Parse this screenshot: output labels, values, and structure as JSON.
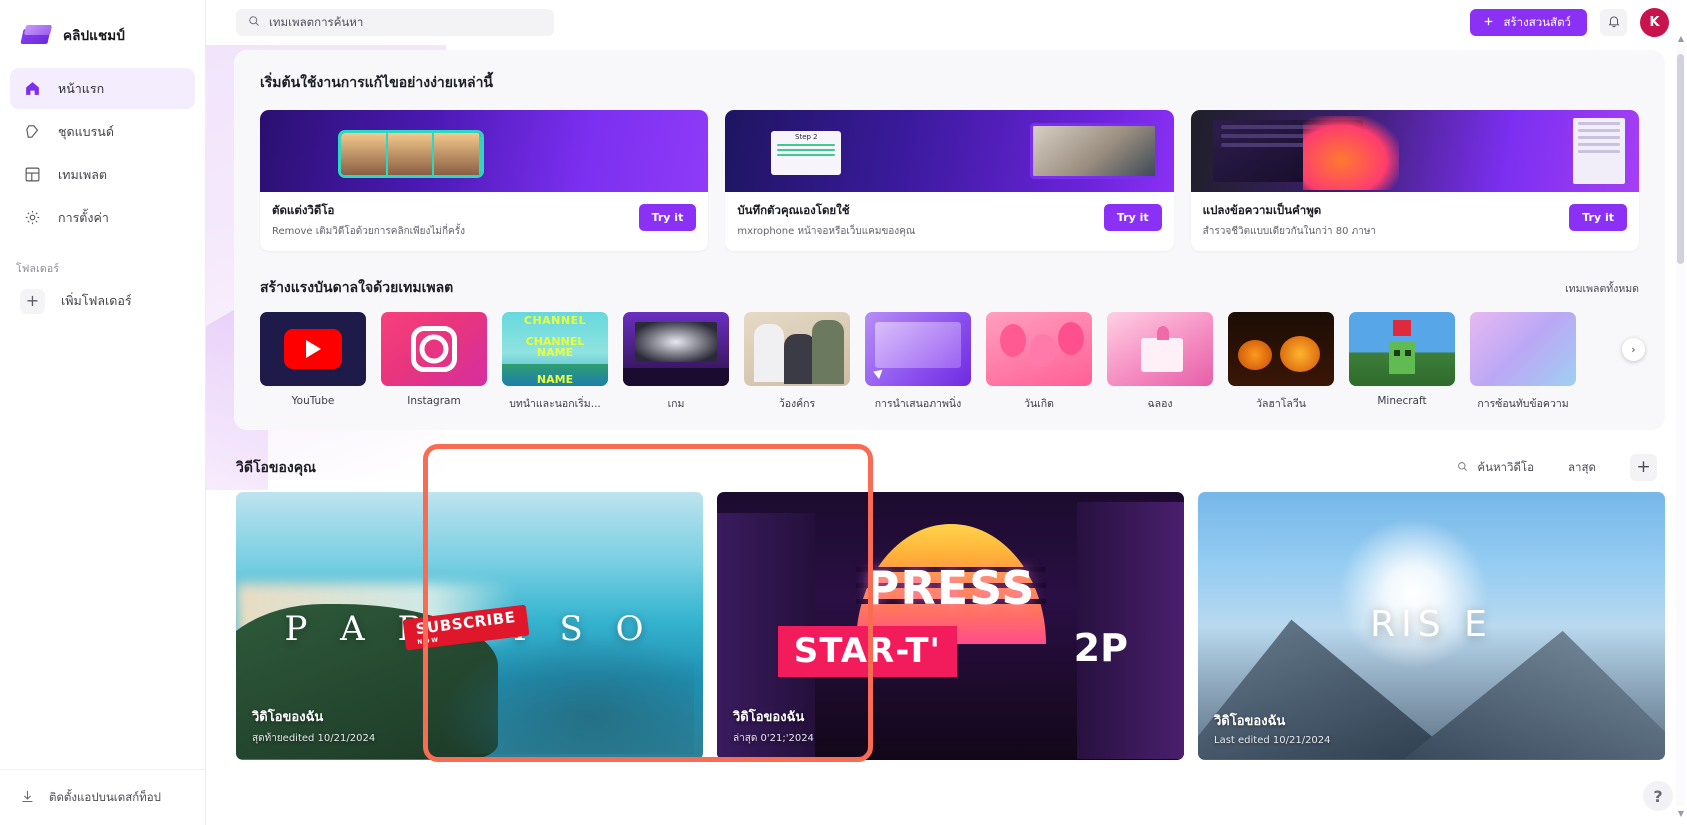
{
  "brand": {
    "name": "คลิปแชมป์",
    "logo_icon": "clipchamp-logo-icon"
  },
  "sidebar": {
    "items": [
      {
        "label": "หน้าแรก",
        "icon": "home-icon",
        "active": true
      },
      {
        "label": "ชุดแบรนด์",
        "icon": "brand-kit-icon",
        "active": false
      },
      {
        "label": "เทมเพลต",
        "icon": "templates-grid-icon",
        "active": false
      },
      {
        "label": "การตั้งค่า",
        "icon": "gear-icon",
        "active": false
      }
    ],
    "folders_label": "โฟลเดอร์",
    "add_folder_label": "เพิ่มโฟลเดอร์",
    "install_app_label": "ติดตั้งแอปบนเดสก์ท็อป"
  },
  "topbar": {
    "search_value": "เทมเพลตการค้นหา",
    "search_icon": "search-icon",
    "create_label": "สร้างสวนสัตว์",
    "bell_icon": "bell-icon",
    "avatar_initial": "K",
    "accent_color": "#8b30f5",
    "avatar_color": "#c9134f"
  },
  "starter": {
    "title": "เริ่มต้นใช้งานการแก้ไขอย่างง่ายเหล่านี้",
    "cards": [
      {
        "title": "ตัดแต่งวิดีโอ",
        "sub": "Remove เติมวิดีโอด้วยการคลิกเพียงไม่กี่ครั้ง",
        "cta": "Try it"
      },
      {
        "title": "บันทึกตัวคุณเองโดยใช้",
        "sub": "mxrophone หน้าจอหรือเว็บแคมของคุณ",
        "cta": "Try it"
      },
      {
        "title": "แปลงข้อความเป็นคำพูด",
        "sub": "สำรวจชีวิตแบบเดียวกันในกว่า 80 ภาษา",
        "cta": "Try it"
      }
    ]
  },
  "templates": {
    "title": "สร้างแรงบันดาลใจด้วยเทมเพลต",
    "see_all": "เทมเพลตทั้งหมด",
    "next_icon": "chevron-right-icon",
    "items": [
      {
        "label": "YouTube",
        "art": "youtube"
      },
      {
        "label": "Instagram",
        "art": "instagram"
      },
      {
        "label": "บทนำและนอกเริ่ม...",
        "art": "channel-name"
      },
      {
        "label": "เกม",
        "art": "gaming-desk"
      },
      {
        "label": "ว้องค์กร",
        "art": "people-office"
      },
      {
        "label": "การนำเสนอภาพนิ่ง",
        "art": "purple-slide"
      },
      {
        "label": "วันเกิด",
        "art": "balloons"
      },
      {
        "label": "ฉลอง",
        "art": "gift"
      },
      {
        "label": "วัลฮาโลวีน",
        "art": "halloween"
      },
      {
        "label": "Minecraft",
        "art": "minecraft"
      },
      {
        "label": "การซ้อนทับข้อความ",
        "art": "text-overlay"
      }
    ]
  },
  "your_videos": {
    "title": "วิดีโอของคุณ",
    "search_label": "ค้นหาวิดีโอ",
    "search_icon": "search-icon",
    "sort_label": "ลาสุด",
    "add_icon": "plus-icon",
    "highlight_color": "#f96b52",
    "cards": [
      {
        "name": "วิดิโอของฉัน",
        "edited": "สุดท้ายedited 10/21/2024",
        "art": "paraiso-island",
        "overlay_text": "P A R A I S O",
        "badge": "SUBSCRIBE",
        "badge_sub": "NOW"
      },
      {
        "name": "วิดิโอของฉัน",
        "edited": "ล่าสุด 0'21;'2024",
        "art": "press-start-2p",
        "overlay_text": "PRESS",
        "line2": "STAR-T'",
        "line3": "2P"
      },
      {
        "name": "วิดิโอของฉัน",
        "edited": "Last edited 10/21/2024",
        "art": "sun-mountains",
        "overlay_text": "RIS   E"
      }
    ]
  },
  "help": {
    "label": "?"
  }
}
